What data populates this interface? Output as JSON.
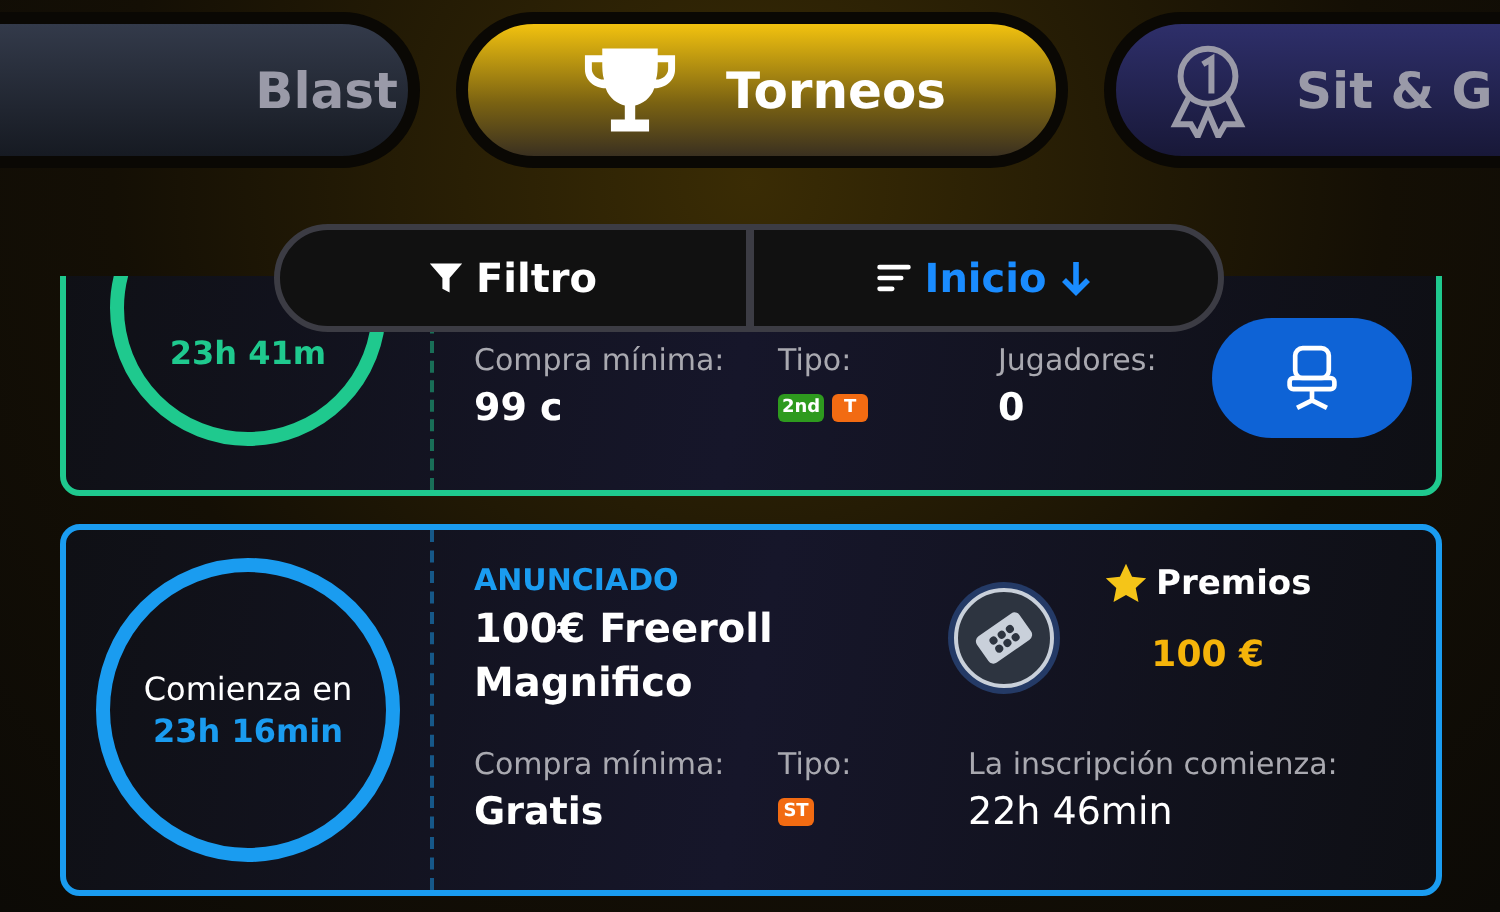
{
  "tabs": [
    {
      "label": "Blast",
      "selected": false,
      "kind": "plain"
    },
    {
      "label": "Torneos",
      "selected": true,
      "kind": "trophy"
    },
    {
      "label": "Sit & G",
      "selected": false,
      "kind": "medal"
    }
  ],
  "toolbar": {
    "filter_label": "Filtro",
    "sort_label": "Inicio"
  },
  "tournaments": [
    {
      "kind": "seat",
      "color": "#1fc98e",
      "time": "23h 41m",
      "buyin_label": "Compra mínima:",
      "buyin": "99 c",
      "type_label": "Tipo:",
      "badges": [
        {
          "text": "2nd",
          "color": "#2e9a1e"
        },
        {
          "text": "T",
          "color": "#f26b12"
        }
      ],
      "info_label": "Jugadores:",
      "info": "0"
    },
    {
      "kind": "announced",
      "color": "#1a9cf0",
      "circle_label": "Comienza en",
      "time": "23h 16min",
      "status": "ANUNCIADO",
      "name": "100€ Freeroll Magnifico",
      "prize_label": "Premios",
      "prize": "100 €",
      "buyin_label": "Compra mínima:",
      "buyin": "Gratis",
      "type_label": "Tipo:",
      "badges": [
        {
          "text": "ST",
          "color": "#f26b12"
        }
      ],
      "info_label": "La inscripción comienza:",
      "info": "22h 46min"
    }
  ]
}
